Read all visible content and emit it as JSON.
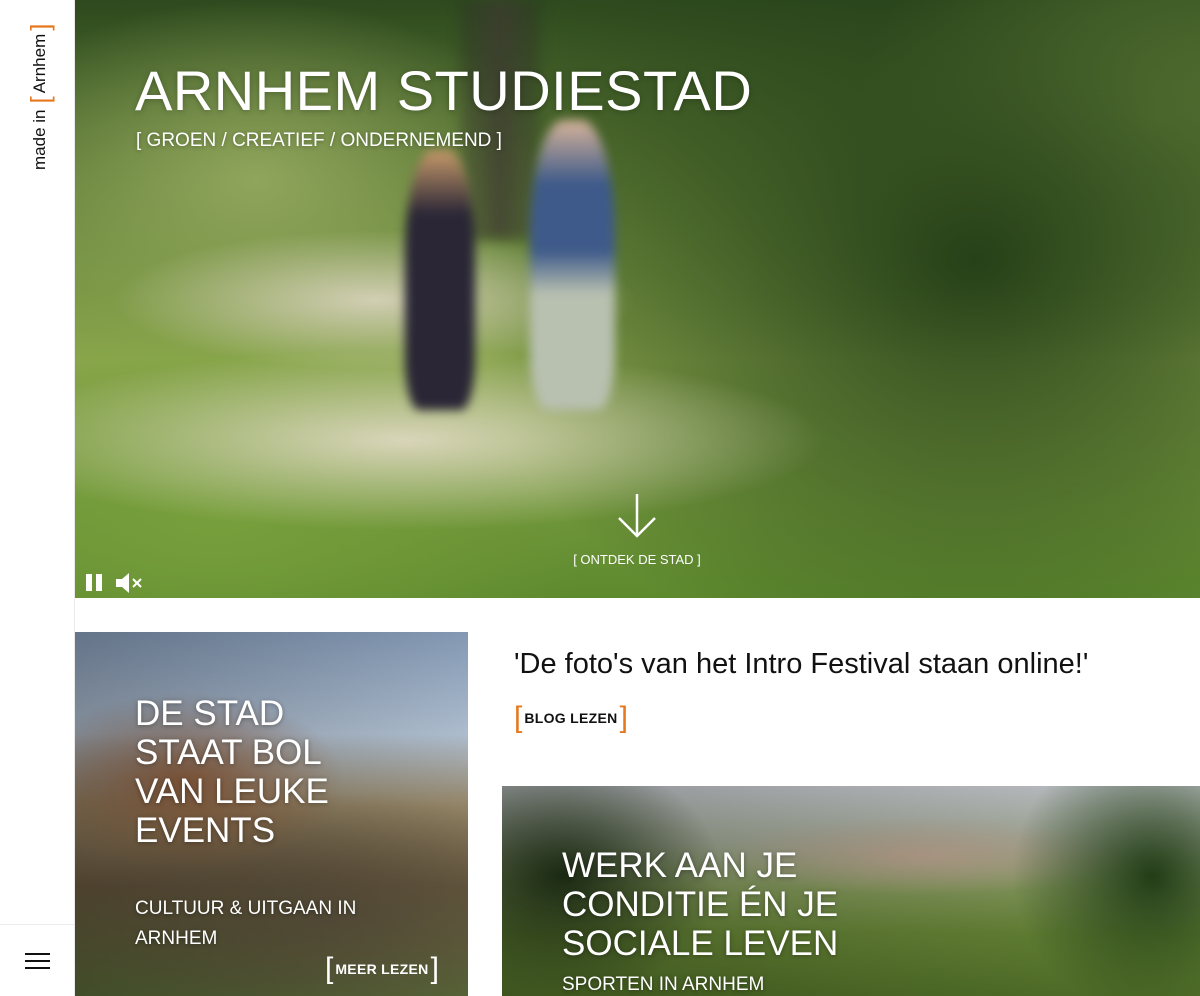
{
  "sidebar": {
    "logo": {
      "prefix": "made in",
      "bracket_left": "[",
      "city": "Arnhem",
      "bracket_right": "]"
    },
    "menu_icon": "hamburger-icon"
  },
  "hero": {
    "title": "ARNHEM STUDIESTAD",
    "subtitle": "[ GROEN / CREATIEF / ONDERNEMEND ]",
    "discover_label": "[ ONTDEK DE STAD ]",
    "controls": {
      "pause_icon": "pause-icon",
      "mute_icon": "mute-icon"
    }
  },
  "events_card": {
    "title": "DE STAD STAAT BOL VAN LEUKE EVENTS",
    "subtitle": "CULTUUR & UITGAAN IN ARNHEM",
    "button_label": "MEER LEZEN"
  },
  "blog": {
    "quote": "'De foto's van het Intro Festival staan online!'",
    "button_label": "BLOG LEZEN"
  },
  "sport_card": {
    "title": "WERK AAN JE CONDITIE ÉN JE SOCIALE LEVEN",
    "subtitle": "SPORTEN IN ARNHEM"
  },
  "colors": {
    "accent": "#e6781e",
    "text": "#111111",
    "background": "#ffffff"
  }
}
